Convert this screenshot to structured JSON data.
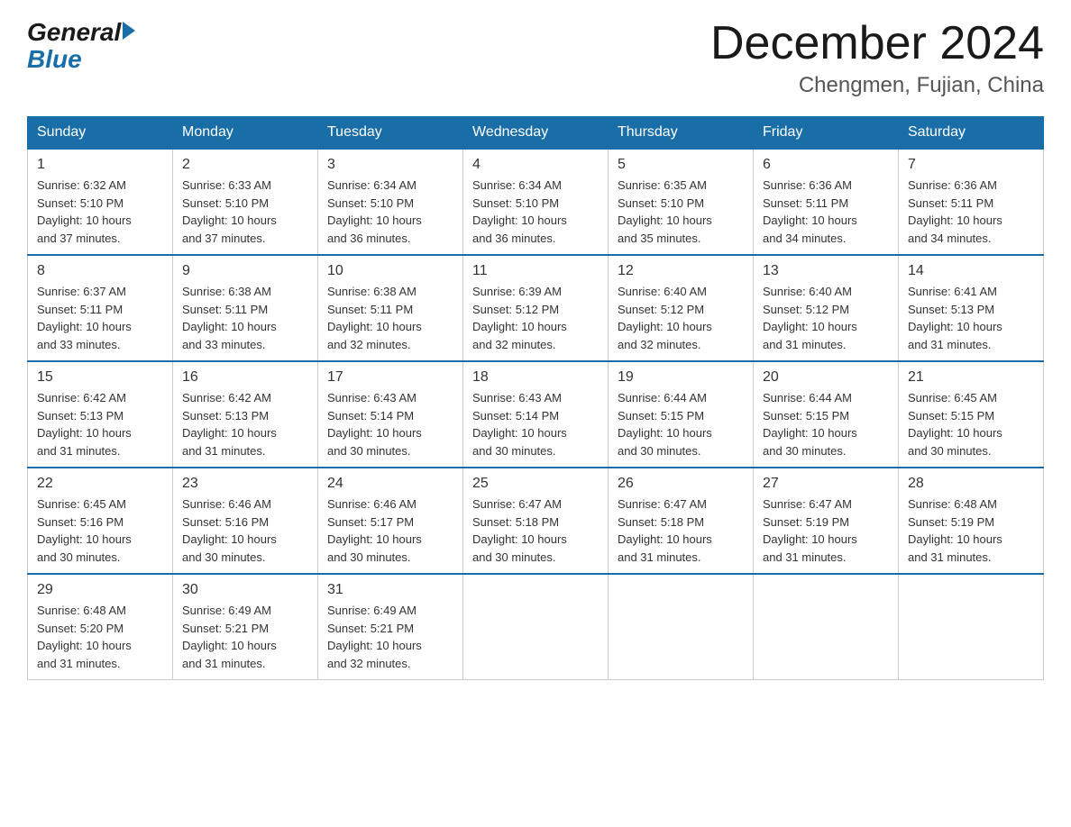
{
  "header": {
    "logo_general": "General",
    "logo_blue": "Blue",
    "month_title": "December 2024",
    "location": "Chengmen, Fujian, China"
  },
  "weekdays": [
    "Sunday",
    "Monday",
    "Tuesday",
    "Wednesday",
    "Thursday",
    "Friday",
    "Saturday"
  ],
  "weeks": [
    [
      {
        "day": "1",
        "sunrise": "6:32 AM",
        "sunset": "5:10 PM",
        "daylight": "10 hours and 37 minutes."
      },
      {
        "day": "2",
        "sunrise": "6:33 AM",
        "sunset": "5:10 PM",
        "daylight": "10 hours and 37 minutes."
      },
      {
        "day": "3",
        "sunrise": "6:34 AM",
        "sunset": "5:10 PM",
        "daylight": "10 hours and 36 minutes."
      },
      {
        "day": "4",
        "sunrise": "6:34 AM",
        "sunset": "5:10 PM",
        "daylight": "10 hours and 36 minutes."
      },
      {
        "day": "5",
        "sunrise": "6:35 AM",
        "sunset": "5:10 PM",
        "daylight": "10 hours and 35 minutes."
      },
      {
        "day": "6",
        "sunrise": "6:36 AM",
        "sunset": "5:11 PM",
        "daylight": "10 hours and 34 minutes."
      },
      {
        "day": "7",
        "sunrise": "6:36 AM",
        "sunset": "5:11 PM",
        "daylight": "10 hours and 34 minutes."
      }
    ],
    [
      {
        "day": "8",
        "sunrise": "6:37 AM",
        "sunset": "5:11 PM",
        "daylight": "10 hours and 33 minutes."
      },
      {
        "day": "9",
        "sunrise": "6:38 AM",
        "sunset": "5:11 PM",
        "daylight": "10 hours and 33 minutes."
      },
      {
        "day": "10",
        "sunrise": "6:38 AM",
        "sunset": "5:11 PM",
        "daylight": "10 hours and 32 minutes."
      },
      {
        "day": "11",
        "sunrise": "6:39 AM",
        "sunset": "5:12 PM",
        "daylight": "10 hours and 32 minutes."
      },
      {
        "day": "12",
        "sunrise": "6:40 AM",
        "sunset": "5:12 PM",
        "daylight": "10 hours and 32 minutes."
      },
      {
        "day": "13",
        "sunrise": "6:40 AM",
        "sunset": "5:12 PM",
        "daylight": "10 hours and 31 minutes."
      },
      {
        "day": "14",
        "sunrise": "6:41 AM",
        "sunset": "5:13 PM",
        "daylight": "10 hours and 31 minutes."
      }
    ],
    [
      {
        "day": "15",
        "sunrise": "6:42 AM",
        "sunset": "5:13 PM",
        "daylight": "10 hours and 31 minutes."
      },
      {
        "day": "16",
        "sunrise": "6:42 AM",
        "sunset": "5:13 PM",
        "daylight": "10 hours and 31 minutes."
      },
      {
        "day": "17",
        "sunrise": "6:43 AM",
        "sunset": "5:14 PM",
        "daylight": "10 hours and 30 minutes."
      },
      {
        "day": "18",
        "sunrise": "6:43 AM",
        "sunset": "5:14 PM",
        "daylight": "10 hours and 30 minutes."
      },
      {
        "day": "19",
        "sunrise": "6:44 AM",
        "sunset": "5:15 PM",
        "daylight": "10 hours and 30 minutes."
      },
      {
        "day": "20",
        "sunrise": "6:44 AM",
        "sunset": "5:15 PM",
        "daylight": "10 hours and 30 minutes."
      },
      {
        "day": "21",
        "sunrise": "6:45 AM",
        "sunset": "5:15 PM",
        "daylight": "10 hours and 30 minutes."
      }
    ],
    [
      {
        "day": "22",
        "sunrise": "6:45 AM",
        "sunset": "5:16 PM",
        "daylight": "10 hours and 30 minutes."
      },
      {
        "day": "23",
        "sunrise": "6:46 AM",
        "sunset": "5:16 PM",
        "daylight": "10 hours and 30 minutes."
      },
      {
        "day": "24",
        "sunrise": "6:46 AM",
        "sunset": "5:17 PM",
        "daylight": "10 hours and 30 minutes."
      },
      {
        "day": "25",
        "sunrise": "6:47 AM",
        "sunset": "5:18 PM",
        "daylight": "10 hours and 30 minutes."
      },
      {
        "day": "26",
        "sunrise": "6:47 AM",
        "sunset": "5:18 PM",
        "daylight": "10 hours and 31 minutes."
      },
      {
        "day": "27",
        "sunrise": "6:47 AM",
        "sunset": "5:19 PM",
        "daylight": "10 hours and 31 minutes."
      },
      {
        "day": "28",
        "sunrise": "6:48 AM",
        "sunset": "5:19 PM",
        "daylight": "10 hours and 31 minutes."
      }
    ],
    [
      {
        "day": "29",
        "sunrise": "6:48 AM",
        "sunset": "5:20 PM",
        "daylight": "10 hours and 31 minutes."
      },
      {
        "day": "30",
        "sunrise": "6:49 AM",
        "sunset": "5:21 PM",
        "daylight": "10 hours and 31 minutes."
      },
      {
        "day": "31",
        "sunrise": "6:49 AM",
        "sunset": "5:21 PM",
        "daylight": "10 hours and 32 minutes."
      },
      null,
      null,
      null,
      null
    ]
  ]
}
